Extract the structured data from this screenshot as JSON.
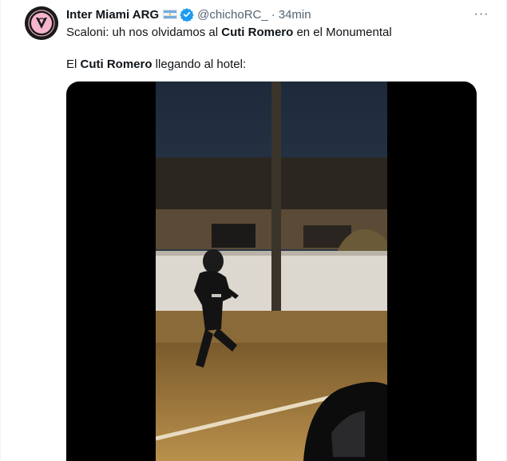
{
  "tweet": {
    "author_name": "Inter Miami ARG",
    "handle": "@chichoRC_",
    "separator": "·",
    "time": "34min",
    "more_label": "···",
    "line1": {
      "before": "Scaloni: uh nos olvidamos al ",
      "bold": "Cuti Romero",
      "after": " en el Monumental"
    },
    "line2": {
      "before": "El ",
      "bold": "Cuti Romero",
      "after": " llegando al hotel:"
    }
  },
  "icons": {
    "avatar": "inter-miami-crest-icon",
    "flag": "argentina-flag-icon",
    "verified": "verified-badge-icon",
    "more": "more-options-icon"
  },
  "colors": {
    "verified": "#1d9bf0",
    "secondary_text": "#536471",
    "primary_text": "#0f1419"
  }
}
